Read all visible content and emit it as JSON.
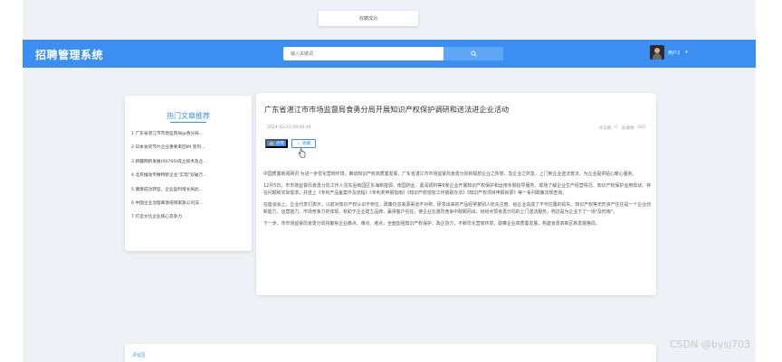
{
  "toast": {
    "message": "收藏成功",
    "ghost_text": "同 "
  },
  "header": {
    "app_title": "招聘管理系统",
    "search": {
      "placeholder": "输入关键词",
      "value": ""
    },
    "user": {
      "name": "用户2",
      "caret": "▾"
    }
  },
  "sidebar": {
    "title": "热门文章推荐",
    "items": [
      "1 广东省湛江市市场监管局@香分局...",
      "2 日本食货节片企业重要率回IM 克列...",
      "3 新疆网新发展(00700)成立技术及企...",
      "4 北京推动专精特新企业\"实现\"双破万...",
      "5 健康成功转型，企业盈利增长如此...",
      "6 中国企业治理离境倍增家族公司法...",
      "7 打造文化企业核心竞争力"
    ]
  },
  "article": {
    "title": "广东省湛江市市场监督局食勇分局开展知识产权保护调研和送法进企业活动",
    "date": "2024-02-23 09:06:44",
    "stats": {
      "clicks_label": "点击数:",
      "clicks": "0",
      "favorites_label": "收藏数:",
      "favorites": "565"
    },
    "like_label": "点赞",
    "favorite_label": "收藏",
    "paragraphs": [
      "中国质量新闻网讯 为进一步优化营商环境，推动知识产权高质量发展，广东省湛江市市场监督局食勇分局积极想企业之所想、急企业之所急，上门到企业送法普法，为企业提供贴心暖心服务。",
      "12月5日，市市场监督局食勇分局工作人员先后到园区东海新能源、南国药业、嘉润调料等8家企业开展知识产权保护和运用专题指导服务。现场了解企业生产经营情况、知识产权保护运用现状、存在问题和实际需求，并送上《专利产品备案作及流程》《专利奖申报指南》《知识产权侵权工作援助办法》《知识产权项目申报目录》等一系列政策法规查询。",
      "在座谈会上，企业代表们表示，以前对知识产权认识不到位，政策信息来源渠道不对称，研发出来的产品经常被别人抢先注册，给企业造成了不可估量的损失。知识产权等无形资产往往是一个企业创新能力、运营能力、市场竞争力的体现，有助于企业建立品牌，赢得客户信任，使企业在激烈竞争中脱颖而出，纷纷点赞食勇分局的上门送法服务，称这是为企业下了一场\"及时雨\"。",
      "下一步，市市场监督局食勇分局将聚焦企业痛点、难点、堵点，全面加强知识产权保护，政企协力，不断优化营商环境，助推企业高质量发展，构建食勇高新区新发展格局。"
    ]
  },
  "bottom_card": {
    "title": "评论区"
  },
  "watermark": "CSDN @bysj703",
  "colors": {
    "primary": "#3b8ef2",
    "page_bg": "#eef1f5"
  },
  "icons": {
    "search": "search-icon",
    "like": "thumb-up-icon",
    "favorite": "star-icon",
    "cursor": "hand-pointer-icon"
  }
}
